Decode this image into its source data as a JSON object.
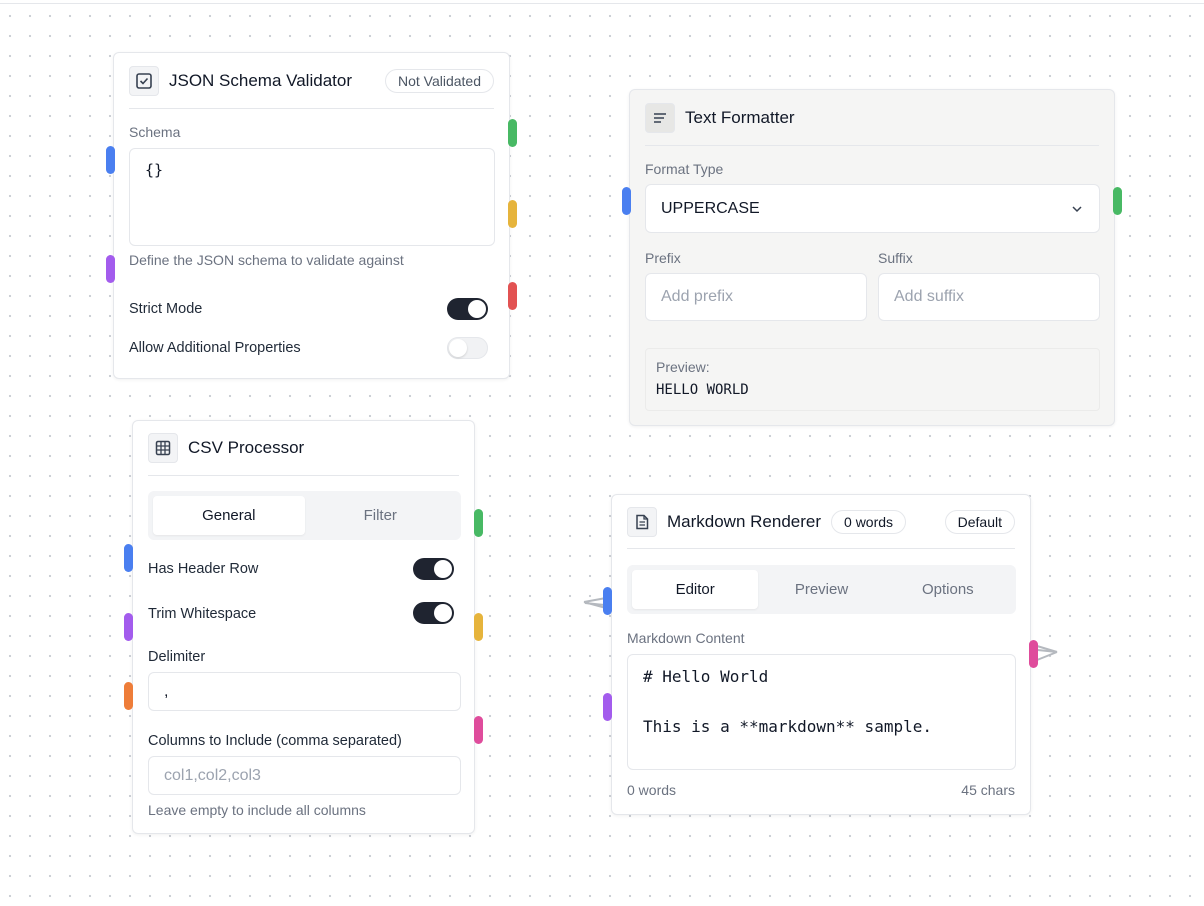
{
  "json_validator": {
    "title": "JSON Schema Validator",
    "status_badge": "Not Validated",
    "schema_label": "Schema",
    "schema_value": "{}",
    "schema_hint": "Define the JSON schema to validate against",
    "strict_mode_label": "Strict Mode",
    "strict_mode_on": true,
    "allow_additional_label": "Allow Additional Properties",
    "allow_additional_on": false,
    "icon": "checkbox-icon"
  },
  "text_formatter": {
    "title": "Text Formatter",
    "format_type_label": "Format Type",
    "format_type_value": "UPPERCASE",
    "prefix_label": "Prefix",
    "prefix_placeholder": "Add prefix",
    "suffix_label": "Suffix",
    "suffix_placeholder": "Add suffix",
    "preview_label": "Preview:",
    "preview_value": "HELLO WORLD",
    "icon": "align-left-icon"
  },
  "csv_processor": {
    "title": "CSV Processor",
    "tabs": [
      "General",
      "Filter"
    ],
    "active_tab": "General",
    "has_header_label": "Has Header Row",
    "has_header_on": true,
    "trim_label": "Trim Whitespace",
    "trim_on": true,
    "delimiter_label": "Delimiter",
    "delimiter_value": ",",
    "columns_label": "Columns to Include (comma separated)",
    "columns_placeholder": "col1,col2,col3",
    "columns_hint": "Leave empty to include all columns",
    "icon": "table-icon"
  },
  "markdown_renderer": {
    "title": "Markdown Renderer",
    "word_badge": "0 words",
    "theme_badge": "Default",
    "tabs": [
      "Editor",
      "Preview",
      "Options"
    ],
    "active_tab": "Editor",
    "content_label": "Markdown Content",
    "content_line1": "# Hello World",
    "content_line2": "This is a **markdown** sample.",
    "footer_words": "0 words",
    "footer_chars": "45 chars",
    "icon": "file-text-icon"
  },
  "handle_colors": {
    "blue": "#4a7ff0",
    "green": "#48b964",
    "yellow": "#e6b43c",
    "red": "#e25252",
    "purple": "#a35ced",
    "orange": "#ee7d39",
    "pink": "#df4c9c"
  }
}
